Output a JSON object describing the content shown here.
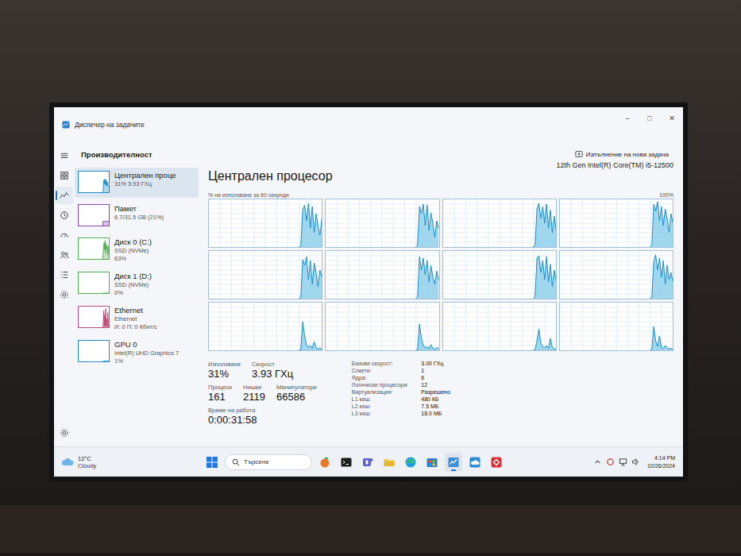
{
  "window": {
    "title": "Диспечер на задачите",
    "controls": [
      "–",
      "□",
      "✕"
    ]
  },
  "header": {
    "title": "Производителност",
    "action": "Изпълнение на нова задача"
  },
  "nav": [
    {
      "kind": "menu",
      "selected": false
    },
    {
      "kind": "processes",
      "selected": false
    },
    {
      "kind": "performance",
      "selected": true
    },
    {
      "kind": "history",
      "selected": false
    },
    {
      "kind": "startup",
      "selected": false
    },
    {
      "kind": "users",
      "selected": false
    },
    {
      "kind": "details",
      "selected": false
    },
    {
      "kind": "services",
      "selected": false
    }
  ],
  "nav_bottom": {
    "kind": "settings",
    "selected": false
  },
  "sidebar": [
    {
      "name": "Централен проце",
      "lines": [
        "31% 3.93 ГХц"
      ],
      "color": "#1a8ec4",
      "selected": true,
      "values": [
        0,
        5,
        55,
        60,
        40,
        65,
        35,
        58,
        30,
        50,
        32,
        28,
        31
      ]
    },
    {
      "name": "Памет",
      "lines": [
        "6.7/31.5 GB (21%)"
      ],
      "color": "#8e44ad",
      "selected": false,
      "values": [
        0,
        21,
        21,
        21,
        21,
        21,
        21,
        21,
        21,
        21,
        21,
        21,
        21
      ]
    },
    {
      "name": "Диск 0 (C:)",
      "lines": [
        "SSD (NVMe)",
        "63%"
      ],
      "color": "#4caf50",
      "selected": false,
      "values": [
        0,
        20,
        63,
        80,
        45,
        90,
        30,
        70,
        50,
        63,
        20,
        40,
        63
      ]
    },
    {
      "name": "Диск 1 (D:)",
      "lines": [
        "SSD (NVMe)",
        "0%"
      ],
      "color": "#4caf50",
      "selected": false,
      "values": [
        0,
        0,
        0,
        0,
        0,
        0,
        0,
        0,
        0,
        0,
        0,
        0,
        0
      ]
    },
    {
      "name": "Ethernet",
      "lines": [
        "Ethernet",
        "И: 0 П: 0 Кбит/с"
      ],
      "color": "#c0497a",
      "selected": false,
      "values": [
        0,
        10,
        80,
        5,
        60,
        2,
        90,
        5,
        40,
        3,
        70,
        2,
        5
      ]
    },
    {
      "name": "GPU 0",
      "lines": [
        "Intel(R) UHD Graphics 7",
        "1%"
      ],
      "color": "#1a8ec4",
      "selected": false,
      "values": [
        0,
        1,
        3,
        2,
        1,
        2,
        1,
        1,
        1,
        2,
        1,
        1,
        1
      ]
    }
  ],
  "cpu": {
    "title": "Централен процесор",
    "model": "12th Gen Intel(R) Core(TM) i5-12500",
    "graph_label": "% на използване за 60 секунди",
    "max": "100%",
    "seconds": 60,
    "cores": [
      {
        "values": [
          0,
          2,
          78,
          88,
          55,
          92,
          40,
          85,
          30,
          70,
          45,
          25,
          60
        ]
      },
      {
        "values": [
          0,
          3,
          85,
          70,
          90,
          45,
          88,
          35,
          72,
          50,
          20,
          55,
          40
        ]
      },
      {
        "values": [
          0,
          5,
          80,
          92,
          60,
          85,
          50,
          90,
          40,
          78,
          30,
          65,
          35
        ]
      },
      {
        "values": [
          0,
          4,
          90,
          75,
          95,
          55,
          85,
          45,
          80,
          60,
          30,
          70,
          50
        ]
      },
      {
        "values": [
          0,
          2,
          82,
          70,
          88,
          40,
          80,
          30,
          75,
          55,
          25,
          60,
          45
        ]
      },
      {
        "values": [
          0,
          3,
          88,
          60,
          85,
          50,
          80,
          35,
          70,
          45,
          30,
          58,
          40
        ]
      },
      {
        "values": [
          0,
          4,
          85,
          90,
          55,
          80,
          40,
          88,
          35,
          72,
          25,
          60,
          38
        ]
      },
      {
        "values": [
          0,
          2,
          78,
          92,
          60,
          85,
          45,
          80,
          30,
          70,
          40,
          55,
          35
        ]
      },
      {
        "values": [
          0,
          1,
          60,
          30,
          12,
          6,
          10,
          4,
          18,
          6,
          3,
          5,
          2
        ]
      },
      {
        "values": [
          0,
          1,
          55,
          25,
          10,
          5,
          8,
          3,
          12,
          4,
          2,
          6,
          3
        ]
      },
      {
        "values": [
          0,
          1,
          20,
          45,
          15,
          8,
          5,
          10,
          4,
          25,
          6,
          3,
          2
        ]
      },
      {
        "values": [
          0,
          2,
          50,
          20,
          8,
          30,
          6,
          4,
          10,
          5,
          3,
          4,
          2
        ]
      }
    ]
  },
  "stats": [
    [
      {
        "label": "Използване",
        "value": "31%"
      },
      {
        "label": "Скорост",
        "value": "3.93 ГХц"
      }
    ],
    [
      {
        "label": "Процеси",
        "value": "161"
      },
      {
        "label": "Нишки",
        "value": "2119"
      },
      {
        "label": "Манипулатори",
        "value": "66586"
      }
    ],
    [
      {
        "label": "Време на работа",
        "value": "0:00:31:58"
      }
    ]
  ],
  "specs": [
    {
      "label": "Базова скорост:",
      "value": "3.00 ГХц"
    },
    {
      "label": "Сокети:",
      "value": "1"
    },
    {
      "label": "Ядра:",
      "value": "6"
    },
    {
      "label": "Логически процесори:",
      "value": "12"
    },
    {
      "label": "Виртуализация:",
      "value": "Разрешено"
    },
    {
      "label": "L1 кеш:",
      "value": "480 КБ"
    },
    {
      "label": "L2 кеш:",
      "value": "7.5 МБ"
    },
    {
      "label": "L3 кеш:",
      "value": "18.0 МБ"
    }
  ],
  "taskbar": {
    "weather": {
      "temp": "12°C",
      "desc": "Cloudy"
    },
    "search": "Търсене",
    "apps": [
      {
        "kind": "fruit",
        "color": "#e8792b",
        "active": false
      },
      {
        "kind": "terminal",
        "color": "#1e1e1e",
        "active": false
      },
      {
        "kind": "teams",
        "color": "#5b5fc7",
        "active": false
      },
      {
        "kind": "folder",
        "color": "#f2c744",
        "active": false
      },
      {
        "kind": "edge",
        "color": "#1b9de2",
        "active": false
      },
      {
        "kind": "store",
        "color": "#2d7dd2",
        "active": false
      },
      {
        "kind": "taskmanager",
        "color": "#3a8fd6",
        "active": true
      },
      {
        "kind": "cloud",
        "color": "#2a8bd8",
        "active": false
      },
      {
        "kind": "app",
        "color": "#d9303a",
        "active": false
      }
    ],
    "time": "4:14 PM",
    "date": "10/26/2024"
  }
}
